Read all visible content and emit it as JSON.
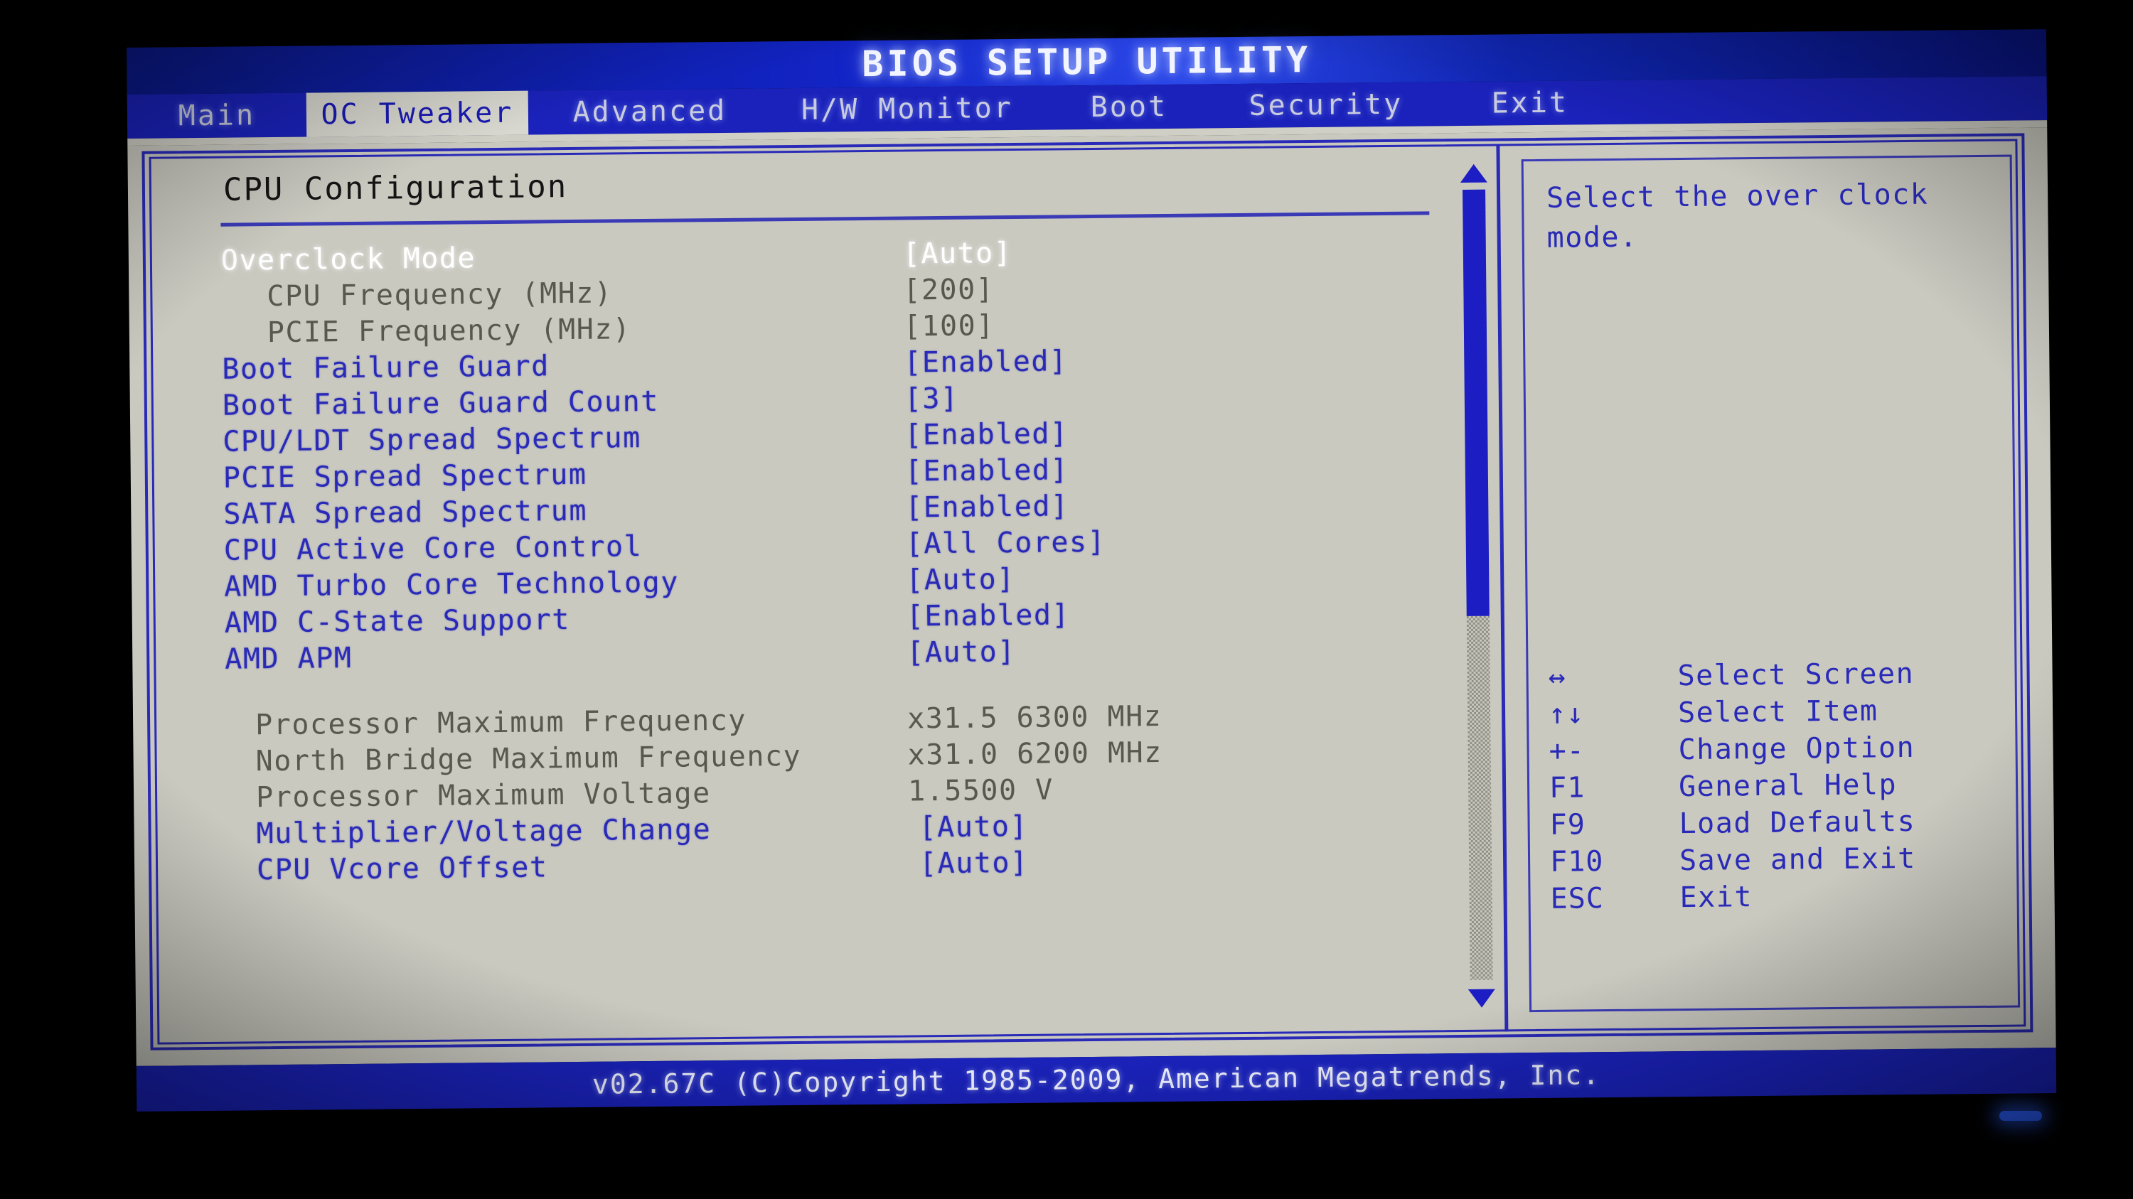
{
  "window": {
    "title": "BIOS SETUP UTILITY"
  },
  "menubar": {
    "tabs": [
      {
        "label": "Main",
        "selected": false
      },
      {
        "label": "OC Tweaker",
        "selected": true
      },
      {
        "label": "Advanced",
        "selected": false
      },
      {
        "label": "H/W Monitor",
        "selected": false
      },
      {
        "label": "Boot",
        "selected": false
      },
      {
        "label": "Security",
        "selected": false
      },
      {
        "label": "Exit",
        "selected": false
      }
    ]
  },
  "main": {
    "section_title": "CPU Configuration",
    "rows": [
      {
        "label": "Overclock Mode",
        "value": "[Auto]",
        "style": "selected",
        "indent": 0
      },
      {
        "label": "CPU Frequency  (MHz)",
        "value": "[200]",
        "style": "disabled",
        "indent": 1
      },
      {
        "label": "PCIE Frequency  (MHz)",
        "value": "[100]",
        "style": "disabled",
        "indent": 1
      },
      {
        "label": "Boot Failure Guard",
        "value": "[Enabled]",
        "style": "normal",
        "indent": 0
      },
      {
        "label": "Boot Failure Guard Count",
        "value": "[3]",
        "style": "normal",
        "indent": 0
      },
      {
        "label": "CPU/LDT Spread Spectrum",
        "value": "[Enabled]",
        "style": "normal",
        "indent": 0
      },
      {
        "label": "PCIE Spread Spectrum",
        "value": "[Enabled]",
        "style": "normal",
        "indent": 0
      },
      {
        "label": "SATA Spread Spectrum",
        "value": "[Enabled]",
        "style": "normal",
        "indent": 0
      },
      {
        "label": "CPU Active Core Control",
        "value": "[All Cores]",
        "style": "normal",
        "indent": 0
      },
      {
        "label": "AMD Turbo Core Technology",
        "value": "[Auto]",
        "style": "normal",
        "indent": 0
      },
      {
        "label": "AMD C-State Support",
        "value": "[Enabled]",
        "style": "normal",
        "indent": 0
      },
      {
        "label": "AMD APM",
        "value": "[Auto]",
        "style": "normal",
        "indent": 0
      }
    ],
    "info_rows": [
      {
        "label": "Processor Maximum Frequency",
        "value": "x31.5 6300 MHz",
        "style": "readonly",
        "indent": 2
      },
      {
        "label": "North Bridge Maximum Frequency",
        "value": "x31.0 6200 MHz",
        "style": "readonly",
        "indent": 2
      },
      {
        "label": "Processor Maximum Voltage",
        "value": "1.5500 V",
        "style": "readonly",
        "indent": 2
      },
      {
        "label": "Multiplier/Voltage Change",
        "value": "[Auto]",
        "style": "normal",
        "indent": 2
      },
      {
        "label": "CPU Vcore Offset",
        "value": "[Auto]",
        "style": "normal",
        "indent": 2
      }
    ],
    "scrollbar": {
      "up_arrow": "triangle-up-icon",
      "down_arrow": "triangle-down-icon",
      "thumb_position_percent": 0,
      "thumb_size_percent": 54
    }
  },
  "help": {
    "text": "Select the over clock mode.",
    "legend": [
      {
        "key": "↔",
        "desc": "Select Screen"
      },
      {
        "key": "↑↓",
        "desc": "Select Item"
      },
      {
        "key": "+-",
        "desc": "Change Option"
      },
      {
        "key": "F1",
        "desc": "General Help"
      },
      {
        "key": "F9",
        "desc": "Load Defaults"
      },
      {
        "key": "F10",
        "desc": "Save and Exit"
      },
      {
        "key": "ESC",
        "desc": "Exit"
      }
    ]
  },
  "footer": {
    "copyright": "v02.67C (C)Copyright 1985-2009, American Megatrends, Inc."
  },
  "colors": {
    "menubar_blue": "#1a22bb",
    "text_blue": "#2a2ab8",
    "selected_white": "#ffffff",
    "disabled_gray": "#58584f",
    "heading_dark": "#141414",
    "console_bg": "#c9c9c0",
    "tab_selected_bg": "#d8d8d0"
  }
}
